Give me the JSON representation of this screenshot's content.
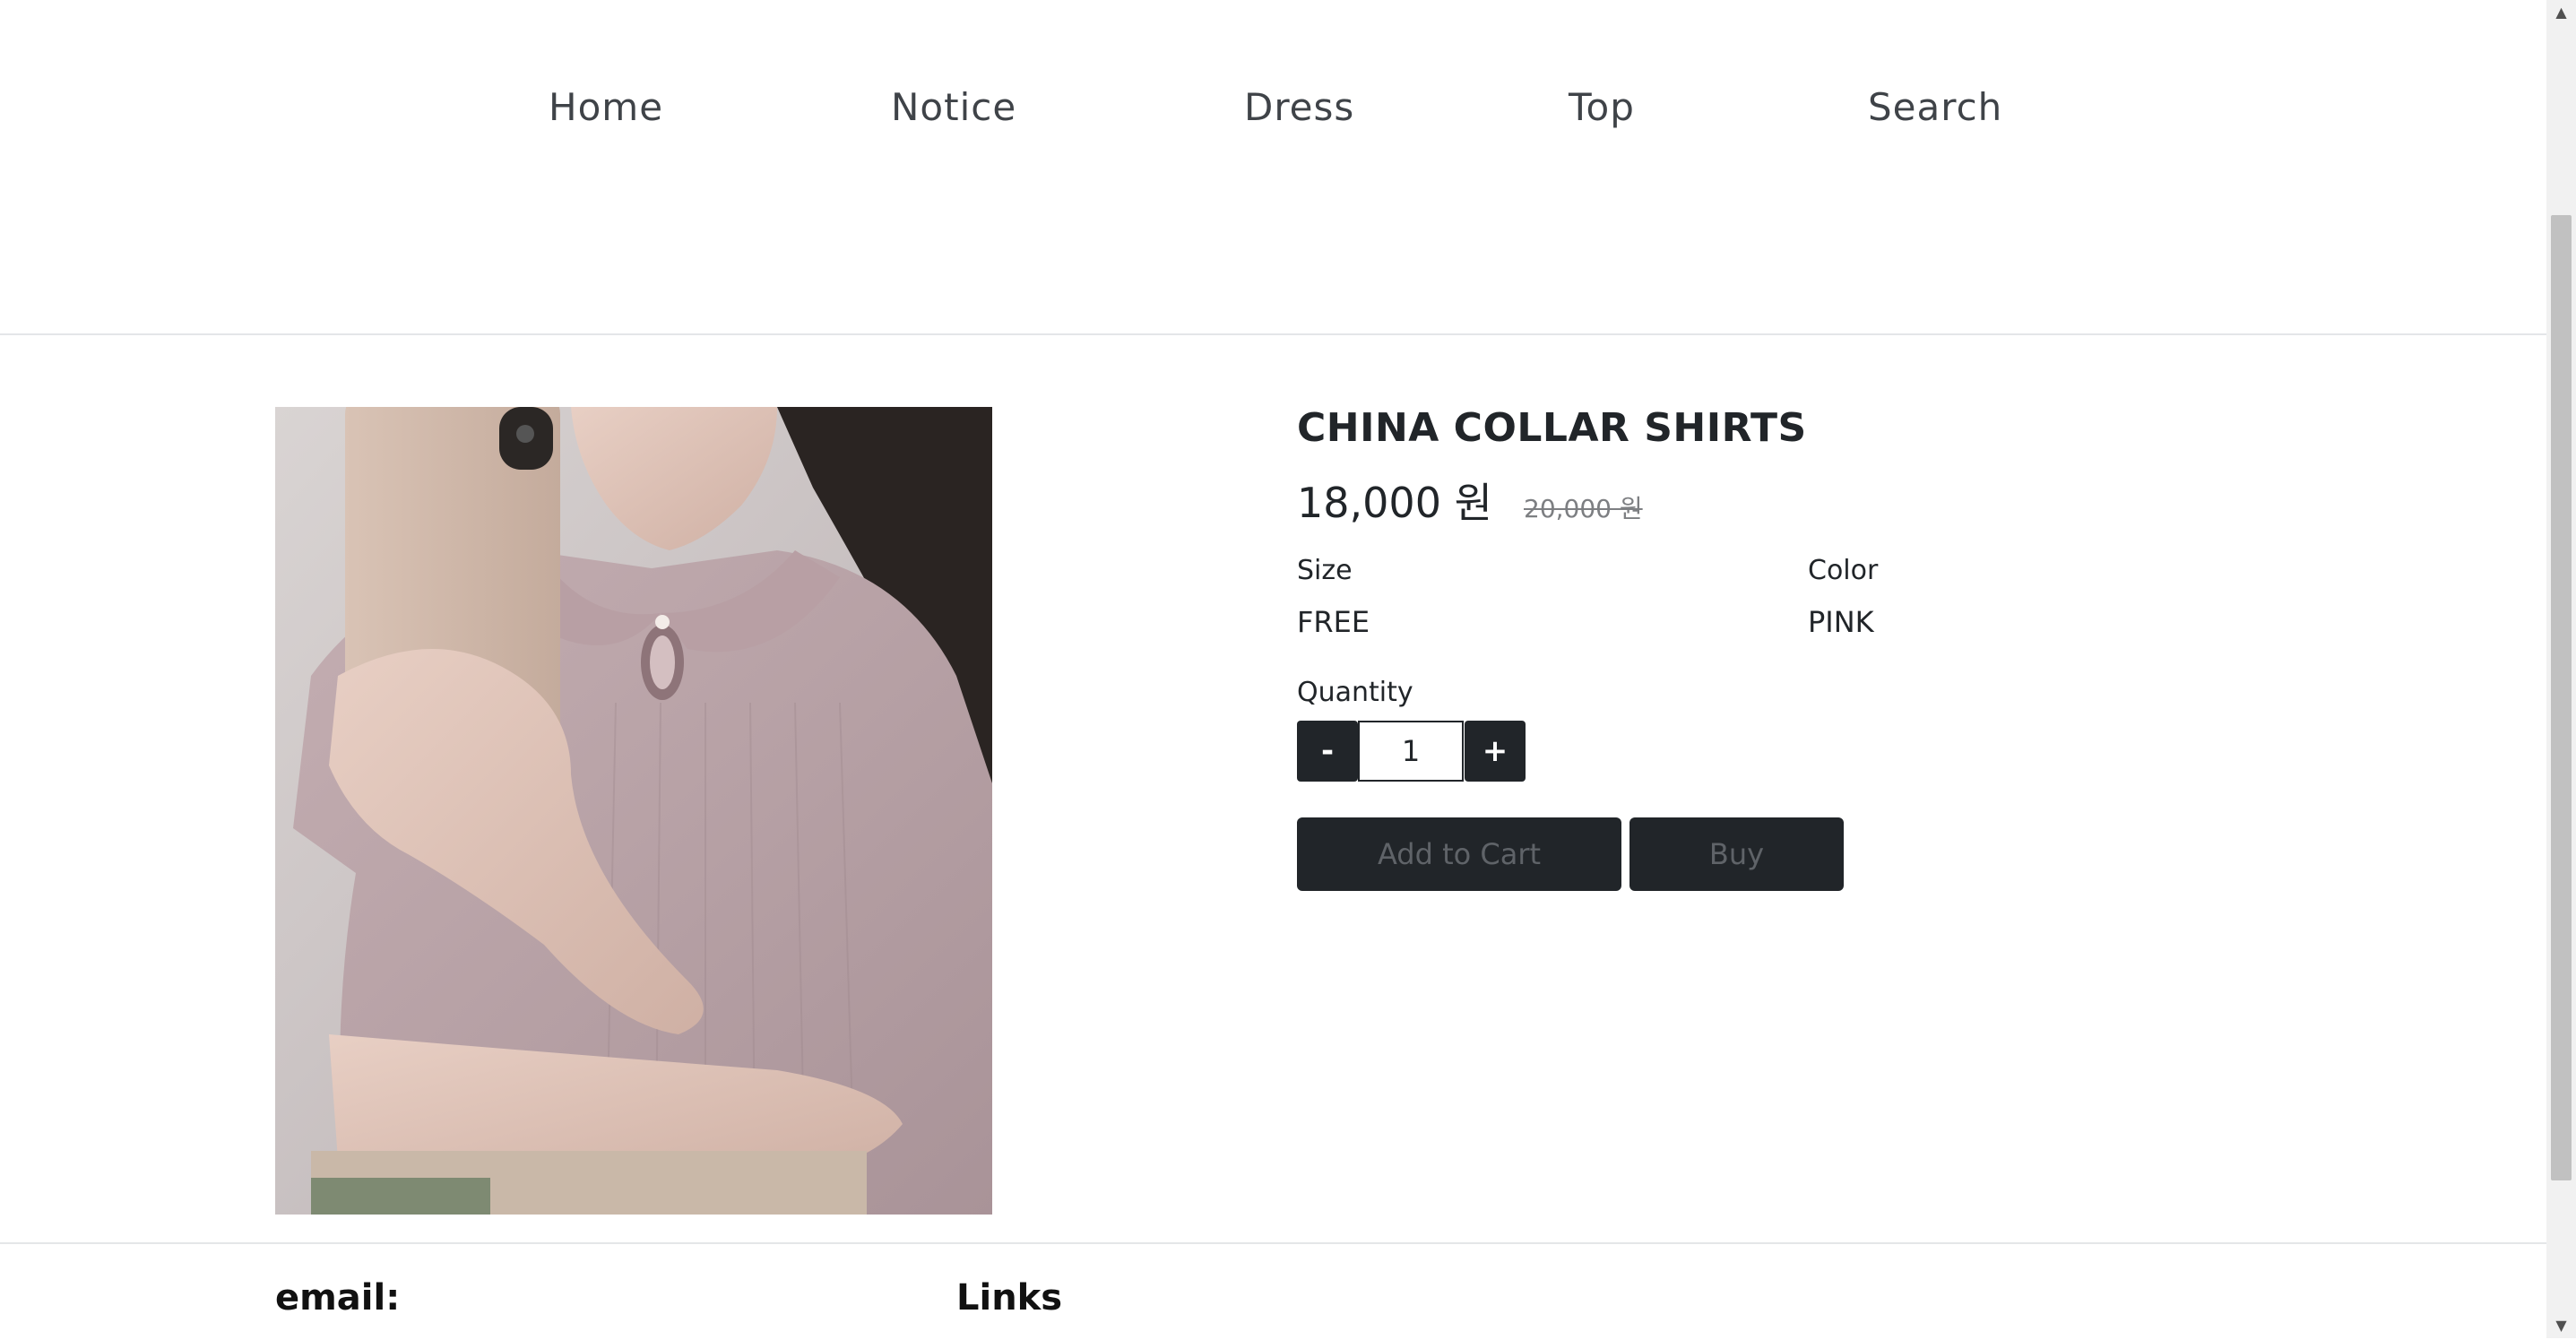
{
  "nav": {
    "items": [
      {
        "label": "Home"
      },
      {
        "label": "Notice"
      },
      {
        "label": "Dress"
      },
      {
        "label": "Top"
      },
      {
        "label": "Search"
      }
    ]
  },
  "product": {
    "title": "CHINA COLLAR SHIRTS",
    "price": "18,000 원",
    "original_price": "20,000 원",
    "size_label": "Size",
    "size_value": "FREE",
    "color_label": "Color",
    "color_value": "PINK",
    "quantity_label": "Quantity",
    "quantity_value": "1",
    "decrement_label": "-",
    "increment_label": "+",
    "add_to_cart_label": "Add to Cart",
    "buy_label": "Buy"
  },
  "footer": {
    "email_heading": "email:",
    "links_heading": "Links"
  },
  "colors": {
    "button_dark": "#212529",
    "button_text_muted": "#5f6368",
    "divider": "#e4e6e8",
    "old_price": "#7d7f82"
  }
}
